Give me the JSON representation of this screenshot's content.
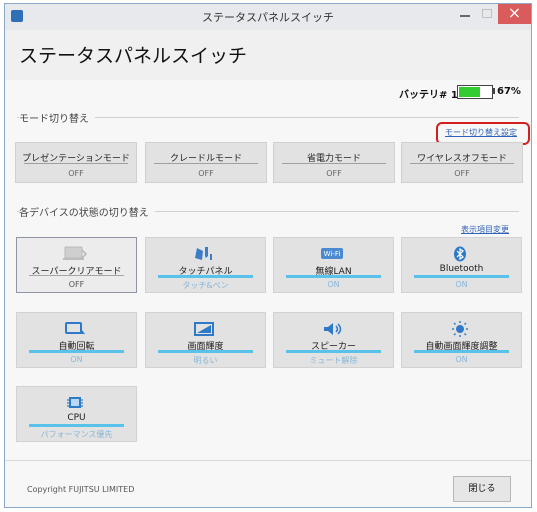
{
  "window": {
    "title": "ステータスパネルスイッチ"
  },
  "header": {
    "title": "ステータスパネルスイッチ"
  },
  "battery": {
    "label": "バッテリ# 1",
    "percent_text": "67%",
    "level": 67,
    "fill_color": "#33cc33"
  },
  "mode_section": {
    "title": "モード切り替え",
    "link": "モード切り替え設定",
    "buttons": [
      {
        "label": "プレゼンテーションモード",
        "state": "OFF"
      },
      {
        "label": "クレードルモード",
        "state": "OFF"
      },
      {
        "label": "省電力モード",
        "state": "OFF"
      },
      {
        "label": "ワイヤレスオフモード",
        "state": "OFF"
      }
    ]
  },
  "device_section": {
    "title": "各デバイスの状態の切り替え",
    "link": "表示項目変更",
    "tiles": [
      {
        "icon": "super-clear-mode-icon",
        "label": "スーパークリアモード",
        "state": "OFF"
      },
      {
        "icon": "touch-panel-icon",
        "label": "タッチパネル",
        "state": "タッチ&ペン"
      },
      {
        "icon": "wireless-lan-icon",
        "label": "無線LAN",
        "state": "ON"
      },
      {
        "icon": "bluetooth-icon",
        "label": "Bluetooth",
        "state": "ON"
      },
      {
        "icon": "auto-rotate-icon",
        "label": "自動回転",
        "state": "ON"
      },
      {
        "icon": "screen-brightness-icon",
        "label": "画面輝度",
        "state": "明るい"
      },
      {
        "icon": "speaker-icon",
        "label": "スピーカー",
        "state": "ミュート解除"
      },
      {
        "icon": "auto-brightness-icon",
        "label": "自動画面輝度調整",
        "state": "ON"
      },
      {
        "icon": "cpu-icon",
        "label": "CPU",
        "state": "パフォーマンス優先"
      }
    ]
  },
  "footer": {
    "copyright": "Copyright FUJITSU LIMITED",
    "close_label": "閉じる"
  },
  "colors": {
    "accent": "#2f62b8",
    "active_bar": "#58c2ea",
    "highlight": "#d21f1f"
  }
}
